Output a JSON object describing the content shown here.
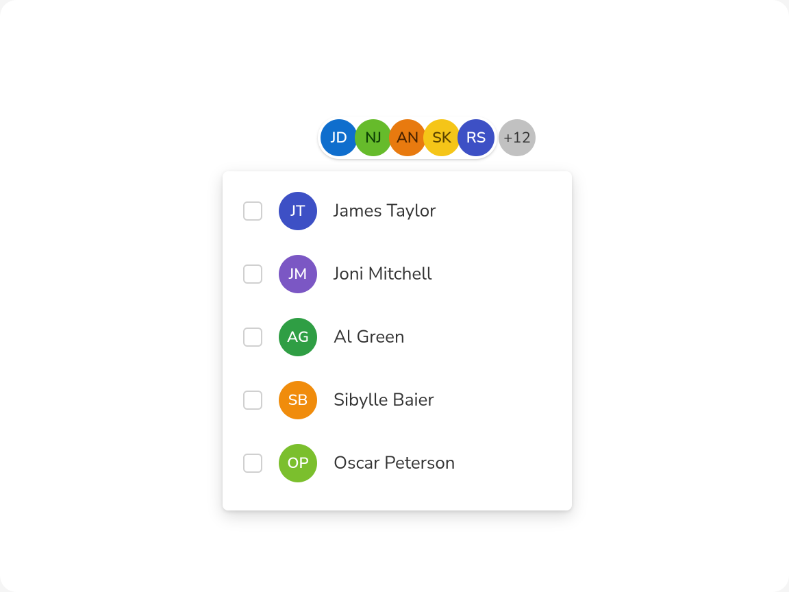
{
  "avatar_group": {
    "avatars": [
      {
        "initials": "JD",
        "bg": "#0f6ecd",
        "fg": "#ffffff"
      },
      {
        "initials": "NJ",
        "bg": "#66bb2b",
        "fg": "#0d4005"
      },
      {
        "initials": "AN",
        "bg": "#e87a0f",
        "fg": "#4a2300"
      },
      {
        "initials": "SK",
        "bg": "#f5c518",
        "fg": "#5a4200"
      },
      {
        "initials": "RS",
        "bg": "#3d50c5",
        "fg": "#ffffff"
      }
    ],
    "overflow": "+12"
  },
  "people_list": {
    "items": [
      {
        "initials": "JT",
        "name": "James Taylor",
        "bg": "#3d50c5",
        "fg": "#ffffff"
      },
      {
        "initials": "JM",
        "name": "Joni Mitchell",
        "bg": "#7b57c4",
        "fg": "#ffffff"
      },
      {
        "initials": "AG",
        "name": "Al Green",
        "bg": "#2f9e44",
        "fg": "#ffffff"
      },
      {
        "initials": "SB",
        "name": "Sibylle Baier",
        "bg": "#f08c0c",
        "fg": "#ffffff"
      },
      {
        "initials": "OP",
        "name": "Oscar Peterson",
        "bg": "#7bbf2d",
        "fg": "#ffffff"
      }
    ]
  }
}
